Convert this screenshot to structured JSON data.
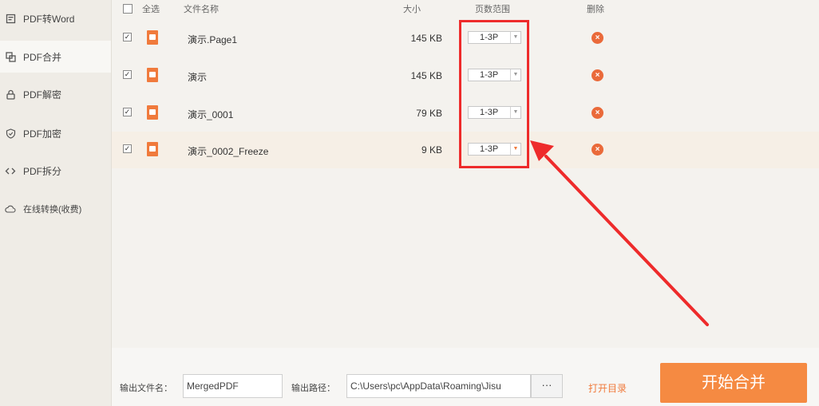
{
  "sidebar": {
    "items": [
      {
        "label": "PDF转Word",
        "icon": "word-icon"
      },
      {
        "label": "PDF合并",
        "icon": "merge-icon"
      },
      {
        "label": "PDF解密",
        "icon": "unlock-icon"
      },
      {
        "label": "PDF加密",
        "icon": "shield-icon"
      },
      {
        "label": "PDF拆分",
        "icon": "split-icon"
      },
      {
        "label": "在线转换(收费)",
        "icon": "cloud-icon"
      }
    ],
    "active_index": 1
  },
  "table": {
    "headers": {
      "select_all": "全选",
      "filename": "文件名称",
      "size": "大小",
      "page_range": "页数范围",
      "delete": "删除"
    },
    "rows": [
      {
        "name": "演示.Page1",
        "size": "145 KB",
        "range": "1-3P",
        "checked": true
      },
      {
        "name": "演示",
        "size": "145 KB",
        "range": "1-3P",
        "checked": true
      },
      {
        "name": "演示_0001",
        "size": "79 KB",
        "range": "1-3P",
        "checked": true
      },
      {
        "name": "演示_0002_Freeze",
        "size": "9 KB",
        "range": "1-3P",
        "checked": true
      }
    ]
  },
  "footer": {
    "output_name_label": "输出文件名：",
    "output_name_value": "MergedPDF",
    "output_path_label": "输出路径：",
    "output_path_value": "C:\\Users\\pc\\AppData\\Roaming\\Jisu",
    "browse_label": "···",
    "open_dir_label": "打开目录",
    "start_label": "开始合并"
  },
  "colors": {
    "accent": "#f58a42",
    "annotation": "#ee2b2b",
    "delete": "#ea6a3a"
  }
}
